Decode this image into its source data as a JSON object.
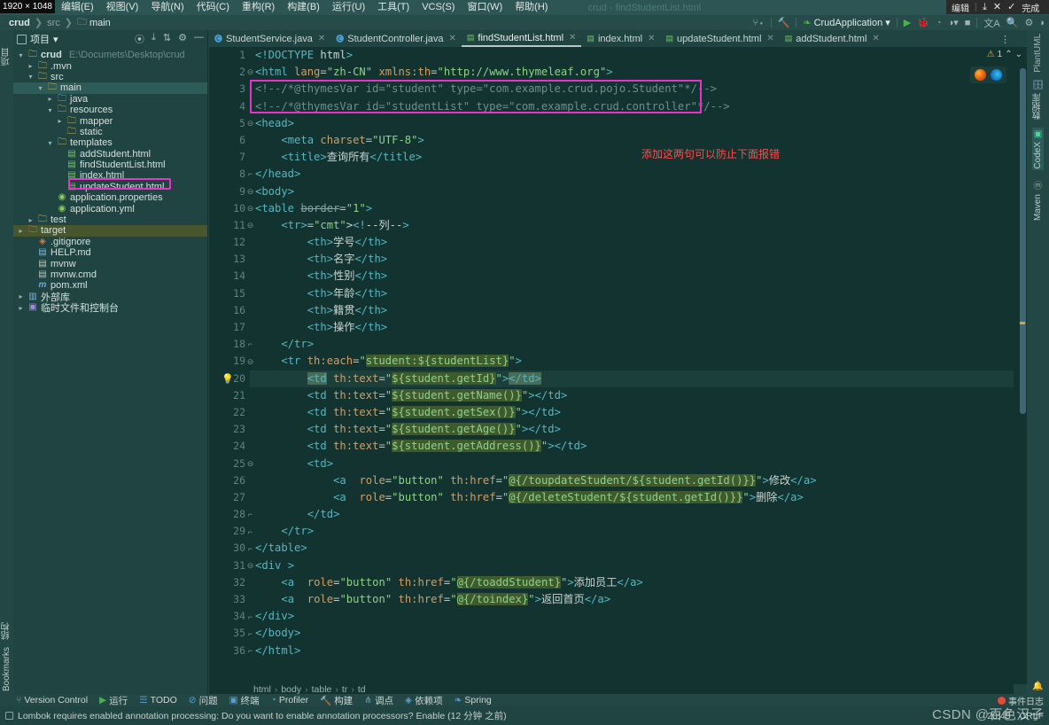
{
  "capture": {
    "size_badge": "1920 × 1048",
    "edit_label": "编辑",
    "save_icon": "download-icon",
    "close_icon": "close-icon",
    "done_icon": "check-icon",
    "done_label": "完成"
  },
  "menubar": {
    "items": [
      "编辑(E)",
      "视图(V)",
      "导航(N)",
      "代码(C)",
      "重构(R)",
      "构建(B)",
      "运行(U)",
      "工具(T)",
      "VCS(S)",
      "窗口(W)",
      "帮助(H)"
    ],
    "window_title": "crud - findStudentList.html"
  },
  "navbar": {
    "crumbs": [
      "crud",
      "src",
      "main"
    ],
    "run_config": "CrudApplication",
    "icons": [
      "git-branch-icon",
      "hammer-icon",
      "run-icon",
      "debug-icon",
      "coverage-icon",
      "profile-icon",
      "stop-icon",
      "translate-icon",
      "search-icon",
      "settings-icon",
      "ide-icon"
    ]
  },
  "left_strip": {
    "top": "项目",
    "bottom": [
      "Bookmarks",
      "结构"
    ]
  },
  "project_panel": {
    "title": "项目",
    "actions": [
      "target-icon",
      "collapse-icon",
      "expand-icon",
      "settings-icon",
      "minimize-icon"
    ],
    "tree": [
      {
        "depth": 0,
        "arrow": "v",
        "icon": "folder-module",
        "label": "crud",
        "bold": true,
        "path": "E:\\Documets\\Desktop\\crud"
      },
      {
        "depth": 1,
        "arrow": ">",
        "icon": "folder",
        "label": ".mvn"
      },
      {
        "depth": 1,
        "arrow": "v",
        "icon": "folder",
        "label": "src"
      },
      {
        "depth": 2,
        "arrow": "v",
        "icon": "folder",
        "label": "main",
        "selected": true
      },
      {
        "depth": 3,
        "arrow": ">",
        "icon": "folder-blue",
        "label": "java"
      },
      {
        "depth": 3,
        "arrow": "v",
        "icon": "folder-res",
        "label": "resources"
      },
      {
        "depth": 4,
        "arrow": ">",
        "icon": "folder",
        "label": "mapper"
      },
      {
        "depth": 4,
        "arrow": "",
        "icon": "folder",
        "label": "static"
      },
      {
        "depth": 3,
        "arrow": "v",
        "icon": "folder",
        "label": "templates"
      },
      {
        "depth": 4,
        "arrow": "",
        "icon": "html-file",
        "label": "addStudent.html"
      },
      {
        "depth": 4,
        "arrow": "",
        "icon": "html-file",
        "label": "findStudentList.html",
        "highlight": true
      },
      {
        "depth": 4,
        "arrow": "",
        "icon": "html-file",
        "label": "index.html"
      },
      {
        "depth": 4,
        "arrow": "",
        "icon": "html-file",
        "label": "updateStudent.html"
      },
      {
        "depth": 3,
        "arrow": "",
        "icon": "yml-file",
        "label": "application.properties"
      },
      {
        "depth": 3,
        "arrow": "",
        "icon": "yml-file",
        "label": "application.yml"
      },
      {
        "depth": 1,
        "arrow": ">",
        "icon": "folder",
        "label": "test"
      },
      {
        "depth": 0,
        "arrow": ">",
        "icon": "folder-red",
        "label": "target",
        "selected2": true
      },
      {
        "depth": 1,
        "arrow": "",
        "icon": "git-file",
        "label": ".gitignore"
      },
      {
        "depth": 1,
        "arrow": "",
        "icon": "md-file",
        "label": "HELP.md"
      },
      {
        "depth": 1,
        "arrow": "",
        "icon": "cmd-file",
        "label": "mvnw"
      },
      {
        "depth": 1,
        "arrow": "",
        "icon": "cmd-file",
        "label": "mvnw.cmd"
      },
      {
        "depth": 1,
        "arrow": "",
        "icon": "maven-file",
        "label": "pom.xml"
      },
      {
        "depth": 0,
        "arrow": ">",
        "icon": "library-icon",
        "label": "外部库"
      },
      {
        "depth": 0,
        "arrow": ">",
        "icon": "scratch-icon",
        "label": "临时文件和控制台"
      }
    ]
  },
  "tabs": [
    {
      "label": "StudentService.java",
      "icon": "java-class-icon",
      "active": false
    },
    {
      "label": "StudentController.java",
      "icon": "java-class-icon",
      "active": false
    },
    {
      "label": "findStudentList.html",
      "icon": "html-file-icon",
      "active": true
    },
    {
      "label": "index.html",
      "icon": "html-file-icon",
      "active": false
    },
    {
      "label": "updateStudent.html",
      "icon": "html-file-icon",
      "active": false
    },
    {
      "label": "addStudent.html",
      "icon": "html-file-icon",
      "active": false
    }
  ],
  "editor": {
    "line_count": 36,
    "current_line": 20,
    "annotation": "添加这两句可以防止下面报错",
    "annotation_color": "#ff4d4d",
    "highlight_color": "#e832c8",
    "lines": [
      "<!DOCTYPE html>",
      "<html lang=\"zh-CN\" xmlns:th=\"http://www.thymeleaf.org\">",
      "<!--/*@thymesVar id=\"student\" type=\"com.example.crud.pojo.Student\"*/-->",
      "<!--/*@thymesVar id=\"studentList\" type=\"com.example.crud.controller\"*/-->",
      "<head>",
      "    <meta charset=\"UTF-8\">",
      "    <title>查询所有</title>",
      "</head>",
      "<body>",
      "<table border=\"1\">",
      "    <tr><!--列-->",
      "        <th>学号</th>",
      "        <th>名字</th>",
      "        <th>性别</th>",
      "        <th>年龄</th>",
      "        <th>籍贯</th>",
      "        <th>操作</th>",
      "    </tr>",
      "    <tr th:each=\"student:${studentList}\">",
      "        <td th:text=\"${student.getId}\"></td>",
      "        <td th:text=\"${student.getName()}\"></td>",
      "        <td th:text=\"${student.getSex()}\"></td>",
      "        <td th:text=\"${student.getAge()}\"></td>",
      "        <td th:text=\"${student.getAddress()}\"></td>",
      "        <td>",
      "            <a  role=\"button\" th:href=\"@{/toupdateStudent/${student.getId()}}\">修改</a>",
      "            <a  role=\"button\" th:href=\"@{/deleteStudent/${student.getId()}}\">删除</a>",
      "        </td>",
      "    </tr>",
      "</table>",
      "<div >",
      "    <a  role=\"button\" th:href=\"@{/toaddStudent}\">添加员工</a>",
      "    <a  role=\"button\" th:href=\"@{/toindex}\">返回首页</a>",
      "</div>",
      "</body>",
      "</html>"
    ]
  },
  "inspections": {
    "warning_count": "1",
    "warn_icon": "warning-triangle-icon",
    "up_icon": "chevron-up-icon",
    "down_icon": "chevron-down-icon"
  },
  "browser_popup": {
    "icons": [
      "firefox-icon",
      "edge-icon"
    ]
  },
  "right_strip": {
    "items": [
      "PlantUML",
      "数据库",
      "CodeX",
      "Maven"
    ]
  },
  "element_path": [
    "html",
    "body",
    "table",
    "tr",
    "td"
  ],
  "bottom_bar": [
    {
      "label": "Version Control",
      "icon": "branch-icon"
    },
    {
      "label": "运行",
      "icon": "run-icon"
    },
    {
      "label": "TODO",
      "icon": "list-icon"
    },
    {
      "label": "问题",
      "icon": "error-icon"
    },
    {
      "label": "终端",
      "icon": "terminal-icon"
    },
    {
      "label": "Profiler",
      "icon": "profiler-icon"
    },
    {
      "label": "构建",
      "icon": "hammer-icon"
    },
    {
      "label": "调点",
      "icon": "dependencies-icon"
    },
    {
      "label": "依赖项",
      "icon": "package-icon"
    },
    {
      "label": "Spring",
      "icon": "spring-icon"
    }
  ],
  "status_bar": {
    "message": "Lombok requires enabled annotation processing: Do you want to enable annotation processors? Enable (12 分钟 之前)",
    "message_icon": "notification-icon",
    "time": "20:45",
    "line_sep": "CRLF"
  },
  "event_log": {
    "label": "事件日志",
    "icon": "alert-dot-icon"
  },
  "watermark": {
    "text": "CSDN @百色汉子",
    "sub": "百色汉子"
  }
}
